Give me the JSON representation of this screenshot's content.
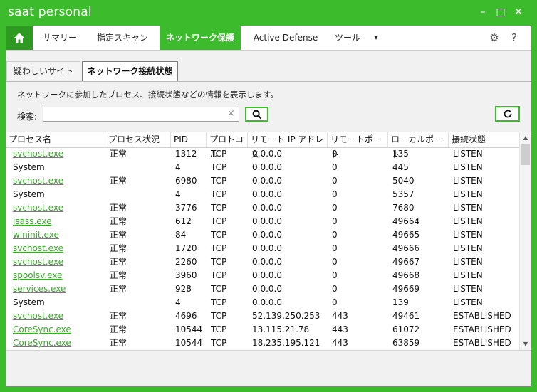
{
  "app": {
    "title": "saat personal"
  },
  "window_controls": {
    "minimize": "–",
    "maximize": "□",
    "close": "✕"
  },
  "nav": {
    "tabs": [
      {
        "label": "サマリー"
      },
      {
        "label": "指定スキャン"
      },
      {
        "label": "ネットワーク保護"
      },
      {
        "label": "Active Defense"
      },
      {
        "label": "ツール"
      }
    ],
    "active_tab": "ネットワーク保護",
    "tools_dropdown": "▾",
    "help": "?"
  },
  "subtabs": [
    {
      "label": "疑わしいサイト"
    },
    {
      "label": "ネットワーク接続状態"
    }
  ],
  "description": "ネットワークに参加したプロセス、接続状態などの情報を表示します。",
  "search": {
    "label": "検索:",
    "value": "",
    "placeholder": "",
    "clear": "×"
  },
  "table": {
    "columns": [
      "プロセス名",
      "プロセス状況",
      "PID",
      "プロトコル",
      "リモート IP アドレス",
      "リモートポート",
      "ローカルポート",
      "接続状態"
    ],
    "rows": [
      [
        "svchost.exe",
        "正常",
        "1312",
        "TCP",
        "0.0.0.0",
        "0",
        "135",
        "LISTEN"
      ],
      [
        "System",
        "",
        "4",
        "TCP",
        "0.0.0.0",
        "0",
        "445",
        "LISTEN"
      ],
      [
        "svchost.exe",
        "正常",
        "6980",
        "TCP",
        "0.0.0.0",
        "0",
        "5040",
        "LISTEN"
      ],
      [
        "System",
        "",
        "4",
        "TCP",
        "0.0.0.0",
        "0",
        "5357",
        "LISTEN"
      ],
      [
        "svchost.exe",
        "正常",
        "3776",
        "TCP",
        "0.0.0.0",
        "0",
        "7680",
        "LISTEN"
      ],
      [
        "lsass.exe",
        "正常",
        "612",
        "TCP",
        "0.0.0.0",
        "0",
        "49664",
        "LISTEN"
      ],
      [
        "wininit.exe",
        "正常",
        "84",
        "TCP",
        "0.0.0.0",
        "0",
        "49665",
        "LISTEN"
      ],
      [
        "svchost.exe",
        "正常",
        "1720",
        "TCP",
        "0.0.0.0",
        "0",
        "49666",
        "LISTEN"
      ],
      [
        "svchost.exe",
        "正常",
        "2260",
        "TCP",
        "0.0.0.0",
        "0",
        "49667",
        "LISTEN"
      ],
      [
        "spoolsv.exe",
        "正常",
        "3960",
        "TCP",
        "0.0.0.0",
        "0",
        "49668",
        "LISTEN"
      ],
      [
        "services.exe",
        "正常",
        "928",
        "TCP",
        "0.0.0.0",
        "0",
        "49669",
        "LISTEN"
      ],
      [
        "System",
        "",
        "4",
        "TCP",
        "0.0.0.0",
        "0",
        "139",
        "LISTEN"
      ],
      [
        "svchost.exe",
        "正常",
        "4696",
        "TCP",
        "52.139.250.253",
        "443",
        "49461",
        "ESTABLISHED"
      ],
      [
        "CoreSync.exe",
        "正常",
        "10544",
        "TCP",
        "13.115.21.78",
        "443",
        "61072",
        "ESTABLISHED"
      ],
      [
        "CoreSync.exe",
        "正常",
        "10544",
        "TCP",
        "18.235.195.121",
        "443",
        "63859",
        "ESTABLISHED"
      ]
    ],
    "linked_rows": [
      0,
      2,
      4,
      5,
      6,
      7,
      8,
      9,
      10,
      12,
      13,
      14
    ]
  },
  "colors": {
    "brand": "#3cbc2c",
    "brand_dark": "#2f9a22",
    "link": "#3aaa2a"
  }
}
